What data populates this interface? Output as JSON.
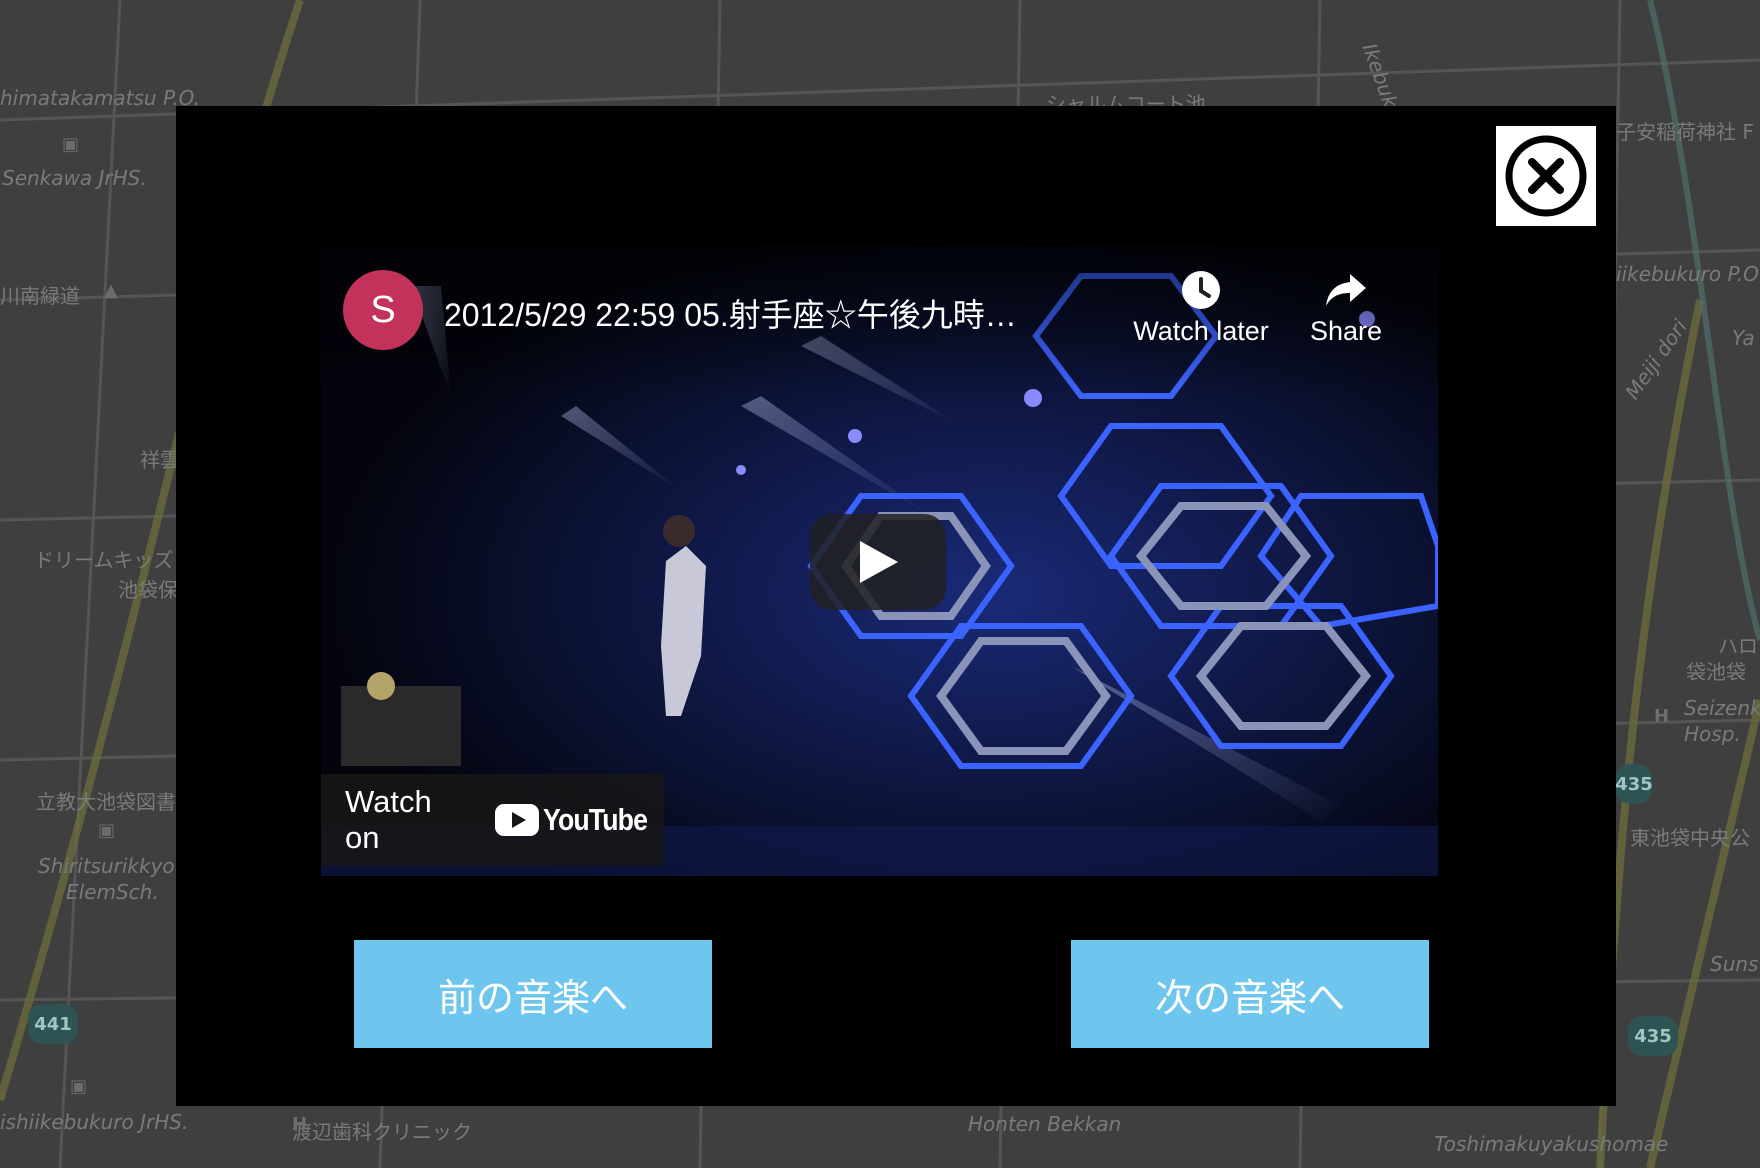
{
  "map": {
    "labels": [
      "himatakamatsu P.O.",
      "Senkawa JrHS.",
      "川南緑道",
      "祥雲",
      "ドリームキッズ",
      "池袋保",
      "立教大池袋図書",
      "Shiritsurikkyou",
      "ElemSch.",
      "ishiikebukuro JrHS.",
      "渡辺歯科クリニック",
      "Honten Bekkan",
      "Toshimakuyakushomae",
      "シャルムコート池",
      "子安稲荷神社 F",
      "iikebukuro P.O",
      "Meiji dori",
      "Ya",
      "ハロー",
      "袋池袋",
      "Seizenk",
      "Hosp.",
      "東池袋中央公",
      "Suns",
      "Ikebuk"
    ],
    "shields": [
      "441",
      "435",
      "435"
    ]
  },
  "modal": {
    "close_icon": "close-circle-x-icon",
    "player": {
      "channel_initial": "S",
      "channel_color": "#c2325b",
      "title": "2012/5/29 22:59 05.射手座☆午後九時…",
      "watch_later_label": "Watch later",
      "share_label": "Share",
      "play_icon": "play-icon",
      "watch_on_label": "Watch on",
      "youtube_wordmark": "YouTube"
    },
    "prev_button": "前の音楽へ",
    "next_button": "次の音楽へ",
    "button_color": "#6ec6ef"
  }
}
